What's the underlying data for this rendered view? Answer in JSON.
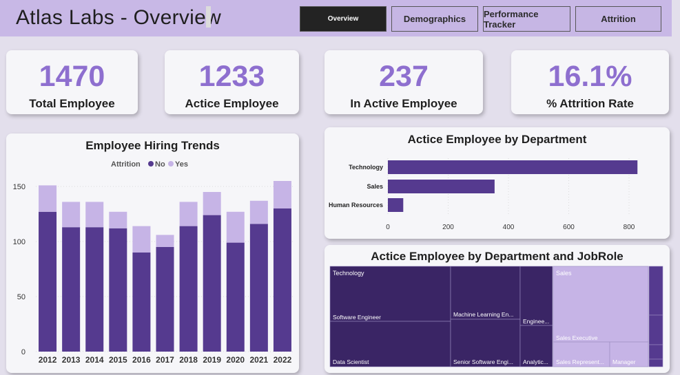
{
  "app": {
    "title": "Atlas Labs - Overview"
  },
  "nav": [
    {
      "label": "Overview",
      "active": true
    },
    {
      "label": "Demographics",
      "active": false
    },
    {
      "label": "Performance Tracker",
      "active": false
    },
    {
      "label": "Attrition",
      "active": false
    }
  ],
  "kpis": [
    {
      "value": "1470",
      "label": "Total Employee"
    },
    {
      "value": "1233",
      "label": "Actice Employee"
    },
    {
      "value": "237",
      "label": "In Active Employee"
    },
    {
      "value": "16.1%",
      "label": "% Attrition Rate"
    }
  ],
  "colors": {
    "accent": "#8e6fcf",
    "no": "#553a8f",
    "yes": "#c6b4e6",
    "treemap_dark": "#3a2565",
    "treemap_light": "#c6b4e6"
  },
  "chart_data": [
    {
      "type": "bar",
      "stacked": true,
      "title": "Employee Hiring Trends",
      "legend_title": "Attrition",
      "legend_position": "top-center",
      "categories": [
        "2012",
        "2013",
        "2014",
        "2015",
        "2016",
        "2017",
        "2018",
        "2019",
        "2020",
        "2021",
        "2022"
      ],
      "series": [
        {
          "name": "No",
          "color": "#553a8f",
          "values": [
            127,
            113,
            113,
            112,
            90,
            95,
            114,
            124,
            99,
            116,
            130
          ]
        },
        {
          "name": "Yes",
          "color": "#c6b4e6",
          "values": [
            24,
            23,
            23,
            15,
            24,
            11,
            22,
            21,
            28,
            21,
            25
          ]
        }
      ],
      "yticks": [
        0,
        50,
        100,
        150
      ],
      "ylim": [
        0,
        160
      ],
      "grid": true
    },
    {
      "type": "bar",
      "orientation": "horizontal",
      "title": "Actice Employee by Department",
      "categories": [
        "Technology",
        "Sales",
        "Human Resources"
      ],
      "values": [
        828,
        354,
        51
      ],
      "xticks": [
        0,
        200,
        400,
        600,
        800
      ],
      "xlim": [
        0,
        900
      ],
      "grid": true
    },
    {
      "type": "treemap",
      "title": "Actice Employee by Department and JobRole",
      "groups": [
        {
          "name": "Technology",
          "roles": [
            {
              "name": "Software Engineer",
              "label": "Software Engineer"
            },
            {
              "name": "Data Scientist",
              "label": "Data Scientist"
            },
            {
              "name": "Machine Learning Engineer",
              "label": "Machine Learning En..."
            },
            {
              "name": "Senior Software Engineer",
              "label": "Senior Software Engi..."
            },
            {
              "name": "Engineering Manager",
              "label": "Enginee..."
            },
            {
              "name": "Analytics Manager",
              "label": "Analytic..."
            }
          ]
        },
        {
          "name": "Sales",
          "roles": [
            {
              "name": "Sales Executive",
              "label": "Sales Executive"
            },
            {
              "name": "Sales Representative",
              "label": "Sales Represent..."
            },
            {
              "name": "Manager",
              "label": "Manager"
            }
          ]
        },
        {
          "name": "Human Resources",
          "roles": []
        }
      ]
    }
  ]
}
